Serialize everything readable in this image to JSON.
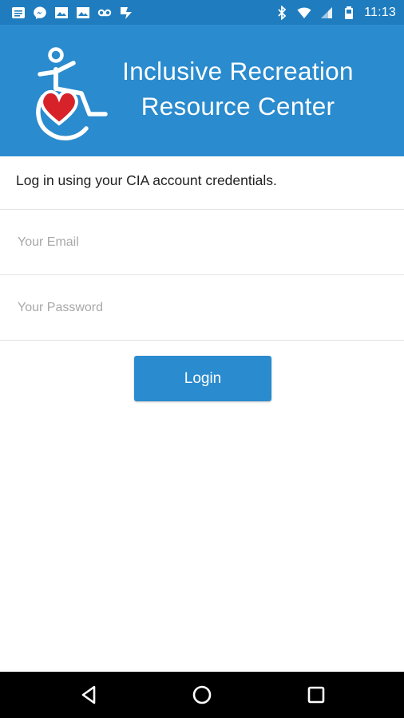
{
  "status_bar": {
    "time": "11:13",
    "left_icons": [
      "message-icon",
      "messenger-icon",
      "gallery-icon",
      "gallery-icon",
      "voicemail-icon",
      "tick-icon"
    ],
    "right_icons": [
      "bluetooth-icon",
      "wifi-icon",
      "signal-icon",
      "battery-icon"
    ]
  },
  "header": {
    "brand_line1": "Inclusive Recreation",
    "brand_line2": "Resource Center",
    "color": "#2a8bce"
  },
  "login": {
    "intro": "Log in using your CIA account credentials.",
    "email_placeholder": "Your Email",
    "password_placeholder": "Your Password",
    "email_value": "",
    "password_value": "",
    "button_label": "Login"
  },
  "nav_bar": {
    "buttons": [
      "back-icon",
      "home-icon",
      "recents-icon"
    ]
  }
}
